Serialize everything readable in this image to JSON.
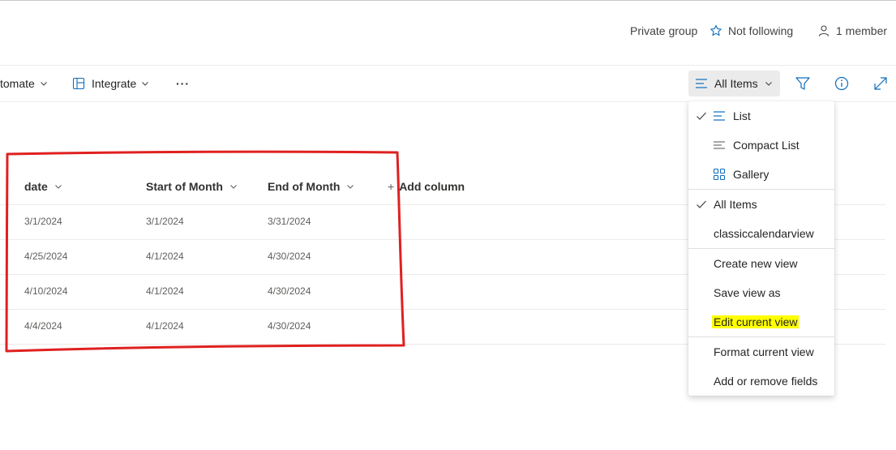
{
  "header": {
    "privacy": "Private group",
    "follow": "Not following",
    "members": "1 member"
  },
  "commandbar": {
    "automate": "tomate",
    "integrate": "Integrate",
    "more": "···",
    "view_label": "All Items"
  },
  "table": {
    "columns": [
      "date",
      "Start of Month",
      "End of Month"
    ],
    "add_column": "Add column",
    "rows": [
      [
        "3/1/2024",
        "3/1/2024",
        "3/31/2024"
      ],
      [
        "4/25/2024",
        "4/1/2024",
        "4/30/2024"
      ],
      [
        "4/10/2024",
        "4/1/2024",
        "4/30/2024"
      ],
      [
        "4/4/2024",
        "4/1/2024",
        "4/30/2024"
      ]
    ]
  },
  "menu": {
    "list": "List",
    "compact_list": "Compact List",
    "gallery": "Gallery",
    "all_items": "All Items",
    "classic": "classiccalendarview",
    "create_view": "Create new view",
    "save_view_as": "Save view as",
    "edit_view": "Edit current view",
    "format_view": "Format current view",
    "add_remove_fields": "Add or remove fields"
  },
  "colors": {
    "accent": "#0f6cbd",
    "annotation_red": "#e02020",
    "highlight": "#ffff00"
  }
}
